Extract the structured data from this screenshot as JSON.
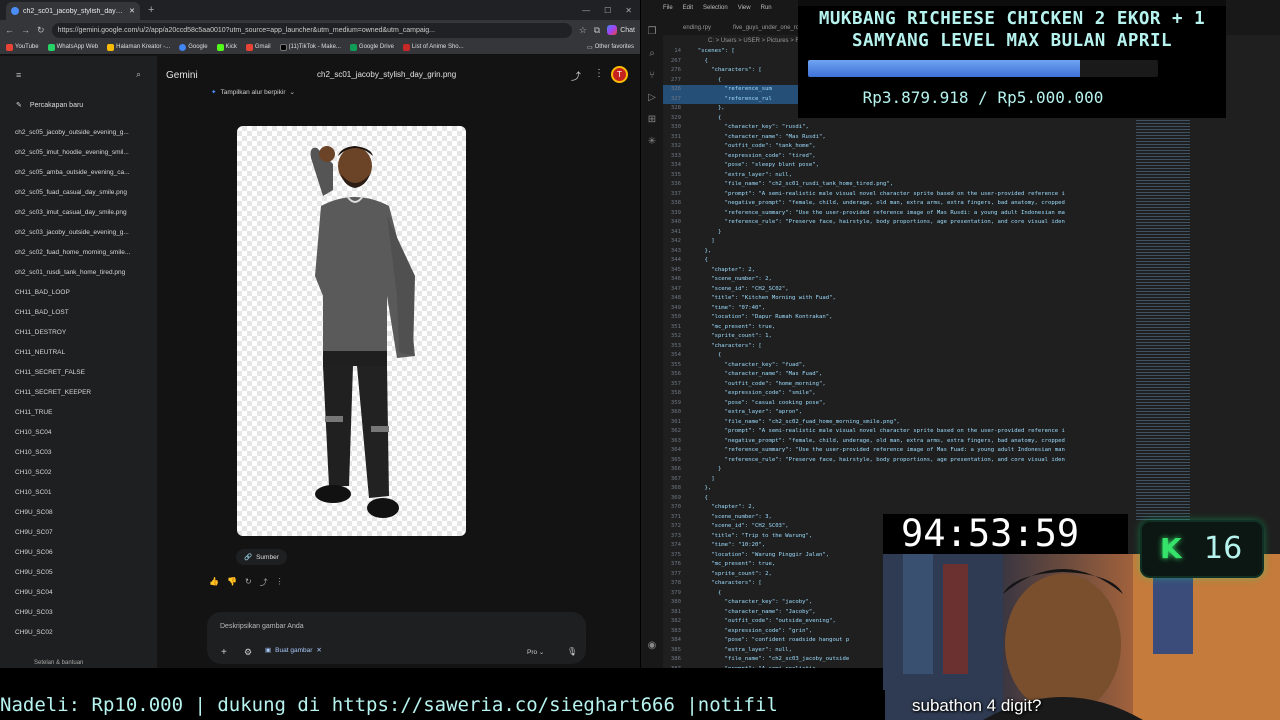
{
  "browser": {
    "tab_title": "ch2_sc01_jacoby_stylish_day_grin.p",
    "url": "https://gemini.google.com/u/2/app/a20ccd58c5aa0010?utm_source=app_launcher&utm_medium=owned&utm_campaig...",
    "chat_label": "Chat",
    "bookmarks": [
      "YouTube",
      "WhatsApp Web",
      "Halaman Kreator -...",
      "Google",
      "Kick",
      "Gmail",
      "(11)TikTok - Make...",
      "Google Drive",
      "List of Anime Sho..."
    ],
    "other_favorites": "Other favorites"
  },
  "gemini": {
    "brand": "Gemini",
    "title": "ch2_sc01_jacoby_stylish_day_grin.png",
    "avatar": "T",
    "new_chat": "Percakapan baru",
    "thinking": "Tampilkan alur berpikir",
    "sidebar_items": [
      "ch2_sc05_jacoby_outside_evening_g...",
      "ch2_sc05_imut_hoodie_evening_smil...",
      "ch2_sc05_amba_outside_evening_ca...",
      "ch2_sc05_fuad_casual_day_smile.png",
      "ch2_sc03_imut_casual_day_smile.png",
      "ch2_sc03_jacoby_outside_evening_g...",
      "ch2_sc02_fuad_home_morning_smile...",
      "ch2_sc01_rusdi_tank_home_tired.png",
      "CH11_BAD_LOOP",
      "CH11_BAD_LOST",
      "CH11_DESTROY",
      "CH11_NEUTRAL",
      "CH11_SECRET_FALSE",
      "CH11_SECRET_KEEPER",
      "CH11_TRUE",
      "CH10_SC04",
      "CH10_SC03",
      "CH10_SC02",
      "CH10_SC01",
      "CH9U_SC08",
      "CH9U_SC07",
      "CH9U_SC06",
      "CH9U_SC05",
      "CH9U_SC04",
      "CH9U_SC03",
      "CH9U_SC02"
    ],
    "sidebar_bottom": "Setelan & bantuan",
    "source_chip": "Sumber",
    "composer_placeholder": "Deskripsikan gambar Anda",
    "create_image_chip": "Buat gambar",
    "model_label": "Pro"
  },
  "vscode": {
    "menu": [
      "File",
      "Edit",
      "Selection",
      "View",
      "Run"
    ],
    "tabs": [
      "ending.rpy",
      "five_guys_under_one_roo"
    ],
    "breadcrumb": "C: > Users > USER > Pictures > Five bool u",
    "code_lines": [
      {
        "n": "14",
        "t": "  \"scenes\": ["
      },
      {
        "n": "267",
        "t": "    {"
      },
      {
        "n": "276",
        "t": "      \"characters\": ["
      },
      {
        "n": "277",
        "t": "        {"
      },
      {
        "n": "326",
        "t": "          \"reference_sum"
      },
      {
        "n": "327",
        "t": "          \"reference_rul"
      },
      {
        "n": "328",
        "t": "        },"
      },
      {
        "n": "329",
        "t": "        {"
      },
      {
        "n": "330",
        "t": "          \"character_key\": \"rusdi\","
      },
      {
        "n": "331",
        "t": "          \"character_name\": \"Mas Rusdi\","
      },
      {
        "n": "332",
        "t": "          \"outfit_code\": \"tank_home\","
      },
      {
        "n": "333",
        "t": "          \"expression_code\": \"tired\","
      },
      {
        "n": "334",
        "t": "          \"pose\": \"sleepy blunt pose\","
      },
      {
        "n": "335",
        "t": "          \"extra_layer\": null,"
      },
      {
        "n": "336",
        "t": "          \"file_name\": \"ch2_sc01_rusdi_tank_home_tired.png\","
      },
      {
        "n": "337",
        "t": "          \"prompt\": \"A semi-realistic male visual novel character sprite based on the user-provided reference i"
      },
      {
        "n": "338",
        "t": "          \"negative_prompt\": \"female, child, underage, old man, extra arms, extra fingers, bad anatomy, cropped"
      },
      {
        "n": "339",
        "t": "          \"reference_summary\": \"Use the user-provided reference image of Mas Rusdi: a young adult Indonesian ma"
      },
      {
        "n": "340",
        "t": "          \"reference_rule\": \"Preserve face, hairstyle, body proportions, age presentation, and core visual iden"
      },
      {
        "n": "341",
        "t": "        }"
      },
      {
        "n": "342",
        "t": "      ]"
      },
      {
        "n": "343",
        "t": "    },"
      },
      {
        "n": "344",
        "t": "    {"
      },
      {
        "n": "345",
        "t": "      \"chapter\": 2,"
      },
      {
        "n": "346",
        "t": "      \"scene_number\": 2,"
      },
      {
        "n": "347",
        "t": "      \"scene_id\": \"CH2_SC02\","
      },
      {
        "n": "348",
        "t": "      \"title\": \"Kitchen Morning with Fuad\","
      },
      {
        "n": "349",
        "t": "      \"time\": \"07:40\","
      },
      {
        "n": "350",
        "t": "      \"location\": \"Dapur Rumah Kontrakan\","
      },
      {
        "n": "351",
        "t": "      \"mc_present\": true,"
      },
      {
        "n": "352",
        "t": "      \"sprite_count\": 1,"
      },
      {
        "n": "353",
        "t": "      \"characters\": ["
      },
      {
        "n": "354",
        "t": "        {"
      },
      {
        "n": "355",
        "t": "          \"character_key\": \"fuad\","
      },
      {
        "n": "356",
        "t": "          \"character_name\": \"Mas Fuad\","
      },
      {
        "n": "357",
        "t": "          \"outfit_code\": \"home_morning\","
      },
      {
        "n": "358",
        "t": "          \"expression_code\": \"smile\","
      },
      {
        "n": "359",
        "t": "          \"pose\": \"casual cooking pose\","
      },
      {
        "n": "360",
        "t": "          \"extra_layer\": \"apron\","
      },
      {
        "n": "361",
        "t": "          \"file_name\": \"ch2_sc02_fuad_home_morning_smile.png\","
      },
      {
        "n": "362",
        "t": "          \"prompt\": \"A semi-realistic male visual novel character sprite based on the user-provided reference i"
      },
      {
        "n": "363",
        "t": "          \"negative_prompt\": \"female, child, underage, old man, extra arms, extra fingers, bad anatomy, cropped"
      },
      {
        "n": "364",
        "t": "          \"reference_summary\": \"Use the user-provided reference image of Mas Fuad: a young adult Indonesian man"
      },
      {
        "n": "365",
        "t": "          \"reference_rule\": \"Preserve face, hairstyle, body proportions, age presentation, and core visual iden"
      },
      {
        "n": "366",
        "t": "        }"
      },
      {
        "n": "367",
        "t": "      ]"
      },
      {
        "n": "368",
        "t": "    },"
      },
      {
        "n": "369",
        "t": "    {"
      },
      {
        "n": "370",
        "t": "      \"chapter\": 2,"
      },
      {
        "n": "371",
        "t": "      \"scene_number\": 3,"
      },
      {
        "n": "372",
        "t": "      \"scene_id\": \"CH2_SC03\","
      },
      {
        "n": "373",
        "t": "      \"title\": \"Trip to the Warung\","
      },
      {
        "n": "374",
        "t": "      \"time\": \"10:20\","
      },
      {
        "n": "375",
        "t": "      \"location\": \"Warung Pinggir Jalan\","
      },
      {
        "n": "376",
        "t": "      \"mc_present\": true,"
      },
      {
        "n": "377",
        "t": "      \"sprite_count\": 2,"
      },
      {
        "n": "378",
        "t": "      \"characters\": ["
      },
      {
        "n": "379",
        "t": "        {"
      },
      {
        "n": "380",
        "t": "          \"character_key\": \"jacoby\","
      },
      {
        "n": "381",
        "t": "          \"character_name\": \"Jacoby\","
      },
      {
        "n": "382",
        "t": "          \"outfit_code\": \"outside_evening\","
      },
      {
        "n": "383",
        "t": "          \"expression_code\": \"grin\","
      },
      {
        "n": "384",
        "t": "          \"pose\": \"confident roadside hangout p"
      },
      {
        "n": "385",
        "t": "          \"extra_layer\": null,"
      },
      {
        "n": "386",
        "t": "          \"file_name\": \"ch2_sc03_jacoby_outside"
      },
      {
        "n": "387",
        "t": "          \"prompt\": \"A semi-realistic"
      }
    ]
  },
  "stream": {
    "goal_title_line1": "MUKBANG RICHEESE CHICKEN 2 EKOR + 1",
    "goal_title_line2": "SAMYANG LEVEL MAX BULAN APRIL",
    "goal_current": "Rp3.879.918",
    "goal_target": "Rp5.000.000",
    "goal_amount_text": "Rp3.879.918 / Rp5.000.000",
    "goal_progress": 0.776,
    "timer": "94:53:59",
    "kick_count": "16",
    "ticker": "Nadeli: Rp10.000  |  dukung di https://saweria.co/sieghart666 |notifil",
    "caption": "subathon 4 digit?",
    "accent_color": "#b6f3ef",
    "kick_color": "#36e36a"
  }
}
